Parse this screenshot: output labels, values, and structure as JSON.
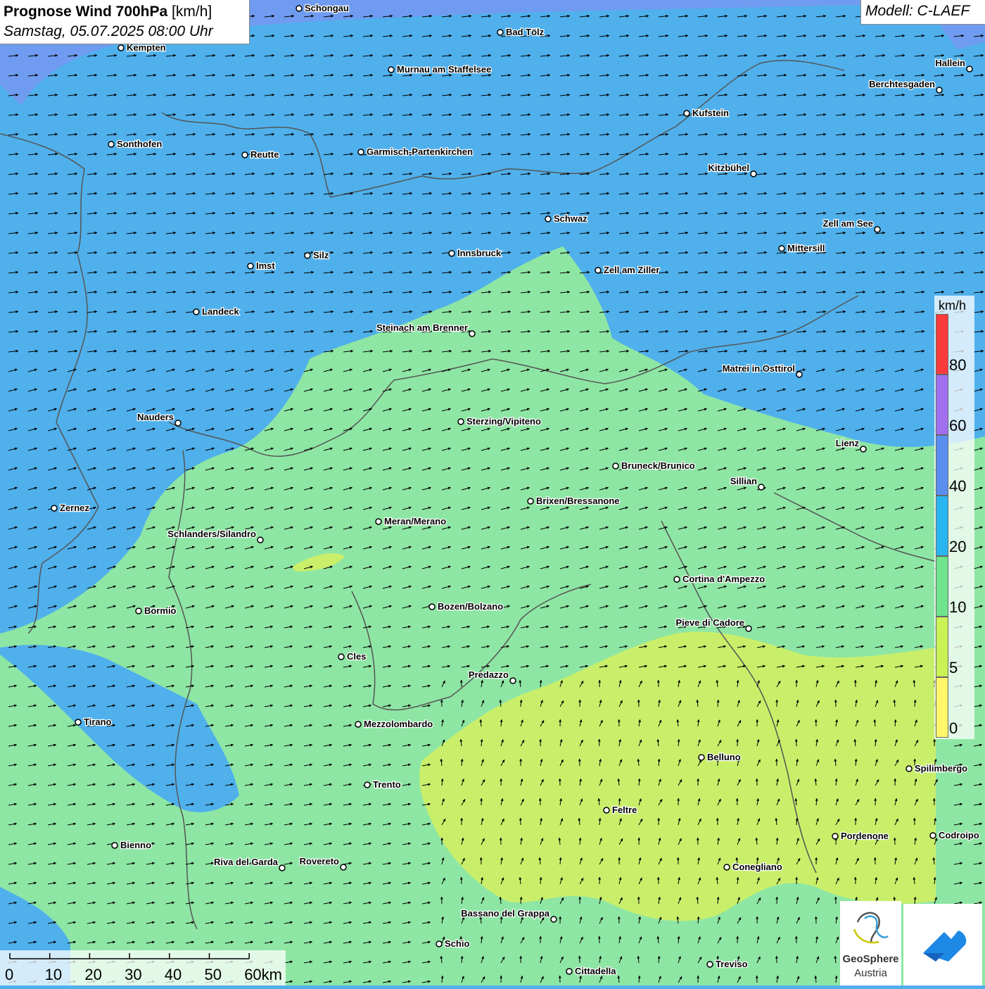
{
  "title": {
    "main": "Prognose Wind 700hPa",
    "unit": "[km/h]",
    "datetime": "Samstag, 05.07.2025 08:00 Uhr"
  },
  "model": "Modell: C-LAEF",
  "legend": {
    "unit": "km/h",
    "labels": [
      "80",
      "60",
      "40",
      "20",
      "10",
      "5",
      "0"
    ],
    "colors": [
      "#ff3b3b",
      "#a070f0",
      "#5a8ff0",
      "#29b6f0",
      "#6fe48c",
      "#c9f255",
      "#fff66a"
    ]
  },
  "scale": {
    "labels": [
      "0",
      "10",
      "20",
      "30",
      "40",
      "50",
      "60km"
    ]
  },
  "colors": {
    "band_20_40": "#4fb0ec",
    "band_40_60": "#6f9cf0",
    "band_10_20": "#8ee6a4",
    "band_5_10": "#c9ef6a",
    "arrows": "#000000",
    "borders": "#555555"
  },
  "cities": [
    {
      "name": "Schongau"
    },
    {
      "name": "Bad Tölz"
    },
    {
      "name": "Kempten"
    },
    {
      "name": "Murnau am Staffelsee"
    },
    {
      "name": "Hallein"
    },
    {
      "name": "Berchtesgaden"
    },
    {
      "name": "Kufstein"
    },
    {
      "name": "Sonthofen"
    },
    {
      "name": "Reutte"
    },
    {
      "name": "Garmisch-Partenkirchen"
    },
    {
      "name": "Kitzbühel"
    },
    {
      "name": "Schwaz"
    },
    {
      "name": "Zell am See"
    },
    {
      "name": "Mittersill"
    },
    {
      "name": "Innsbruck"
    },
    {
      "name": "Silz"
    },
    {
      "name": "Imst"
    },
    {
      "name": "Zell am Ziller"
    },
    {
      "name": "Landeck"
    },
    {
      "name": "Steinach am Brenner"
    },
    {
      "name": "Matrei in Osttirol"
    },
    {
      "name": "Nauders"
    },
    {
      "name": "Sterzing/Vipiteno"
    },
    {
      "name": "Lienz"
    },
    {
      "name": "Bruneck/Brunico"
    },
    {
      "name": "Sillian"
    },
    {
      "name": "Brixen/Bressanone"
    },
    {
      "name": "Zernez"
    },
    {
      "name": "Meran/Merano"
    },
    {
      "name": "Schlanders/Silandro"
    },
    {
      "name": "Cortina d'Ampezzo"
    },
    {
      "name": "Bormio"
    },
    {
      "name": "Bozen/Bolzano"
    },
    {
      "name": "Pieve di Cadore"
    },
    {
      "name": "Cles"
    },
    {
      "name": "Predazzo"
    },
    {
      "name": "Tirano"
    },
    {
      "name": "Mezzolombardo"
    },
    {
      "name": "Belluno"
    },
    {
      "name": "Spilimbergo"
    },
    {
      "name": "Trento"
    },
    {
      "name": "Feltre"
    },
    {
      "name": "Pordenone"
    },
    {
      "name": "Codroipo"
    },
    {
      "name": "Bienno"
    },
    {
      "name": "Riva del Garda"
    },
    {
      "name": "Rovereto"
    },
    {
      "name": "Conegliano"
    },
    {
      "name": "Bassano del Grappa"
    },
    {
      "name": "Schio"
    },
    {
      "name": "Treviso"
    },
    {
      "name": "Cittadella"
    }
  ],
  "logos": {
    "geosphere_line1": "GeoSphere",
    "geosphere_line2": "Austria"
  }
}
